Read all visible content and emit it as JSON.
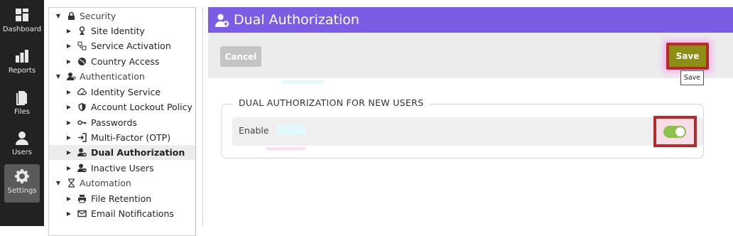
{
  "rail": {
    "items": [
      {
        "label": "Dashboard",
        "icon": "dashboard-icon"
      },
      {
        "label": "Reports",
        "icon": "reports-icon"
      },
      {
        "label": "Files",
        "icon": "files-icon"
      },
      {
        "label": "Users",
        "icon": "users-icon"
      },
      {
        "label": "Settings",
        "icon": "settings-icon",
        "active": true
      }
    ]
  },
  "tree": {
    "items": [
      {
        "label": "Security",
        "type": "group",
        "icon": "lock-icon"
      },
      {
        "label": "Site Identity",
        "icon": "identity-badge-icon"
      },
      {
        "label": "Service Activation",
        "icon": "service-activation-icon"
      },
      {
        "label": "Country Access",
        "icon": "globe-icon"
      },
      {
        "label": "Authentication",
        "type": "group",
        "icon": "user-key-icon"
      },
      {
        "label": "Identity Service",
        "icon": "cloud-sync-icon"
      },
      {
        "label": "Account Lockout Policy",
        "icon": "shield-icon"
      },
      {
        "label": "Passwords",
        "icon": "key-icon"
      },
      {
        "label": "Multi-Factor (OTP)",
        "icon": "sign-in-icon"
      },
      {
        "label": "Dual Authorization",
        "icon": "user-plus-icon",
        "selected": true
      },
      {
        "label": "Inactive Users",
        "icon": "user-minus-icon"
      },
      {
        "label": "Automation",
        "type": "group",
        "icon": "hourglass-icon"
      },
      {
        "label": "File Retention",
        "icon": "printer-icon"
      },
      {
        "label": "Email Notifications",
        "icon": "envelope-icon"
      }
    ]
  },
  "header": {
    "title": "Dual Authorization",
    "icon": "user-plus-icon"
  },
  "toolbar": {
    "cancel_label": "Cancel",
    "save_label": "Save",
    "save_tooltip": "Save"
  },
  "section": {
    "legend": "DUAL AUTHORIZATION FOR NEW USERS",
    "enable_label": "Enable",
    "enabled": true
  },
  "colors": {
    "header_bg": "#7b5ce5",
    "rail_bg": "#222222",
    "save_bg": "#8c8f13",
    "toggle_on": "#8bc34a",
    "highlight_border": "#b72a2a"
  }
}
